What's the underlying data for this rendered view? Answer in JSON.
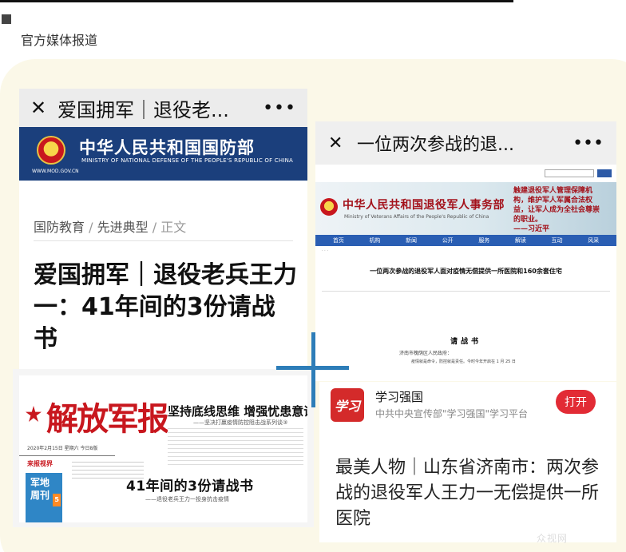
{
  "section": {
    "title": "官方媒体报道"
  },
  "card1": {
    "bar_title": "爱国拥军｜退役老...",
    "site_name_cn": "中华人民共和国国防部",
    "site_name_en": "MINISTRY OF NATIONAL DEFENSE OF THE PEOPLE'S REPUBLIC OF CHINA",
    "site_url": "WWW.MOD.GOV.CN",
    "breadcrumb": [
      "国防教育",
      "先进典型",
      "正文"
    ],
    "headline": "爱国拥军｜退役老兵王力一：41年间的3份请战书"
  },
  "card2": {
    "bar_title": "一位两次参战的退...",
    "site_name_cn": "中华人民共和国退役军人事务部",
    "site_name_en": "Ministry of Veterans Affairs of the People's Republic of China",
    "quote": "触建退役军人管理保障机构，维护军人军属合法权益，让军人成为全社会尊崇的职业。",
    "quote_author": "——习近平",
    "nav": [
      "首页",
      "机构",
      "新闻",
      "公开",
      "服务",
      "解读",
      "互动",
      "风采"
    ],
    "article_title": "一位两次参战的退役军人面对疫情无偿提供一所医院和160余套住宅",
    "doc_title": "请战书",
    "doc_recipient": "济南市槐荫区人民政府：",
    "doc_line": "疫情就是命令，防控就是责任。今时今年开启在 1 月 25 日"
  },
  "card3": {
    "masthead": "解放军报",
    "headline_top": "坚持底线思维 增强忧患意识",
    "sub_top": "——坚决打赢疫情防控阻击战系列谈③",
    "date_line": "2020年2月15日 星期六 今日8版",
    "column_left": "来报视界",
    "tag_text": "军地周刊",
    "tag_num": "5",
    "headline_main": "41年间的3份请战书",
    "sub_main": "——退役老兵王力一投身抗击疫情"
  },
  "card4": {
    "app_name": "学习强国",
    "app_desc": "中共中央宣传部\"学习强国\"学习平台",
    "icon_text": "学习",
    "open_label": "打开",
    "headline": "最美人物｜山东省济南市：两次参战的退役军人王力一无偿提供一所医院"
  },
  "colors": {
    "accent_blue": "#2d7db8",
    "red": "#c8171e"
  },
  "watermark": "众视网"
}
